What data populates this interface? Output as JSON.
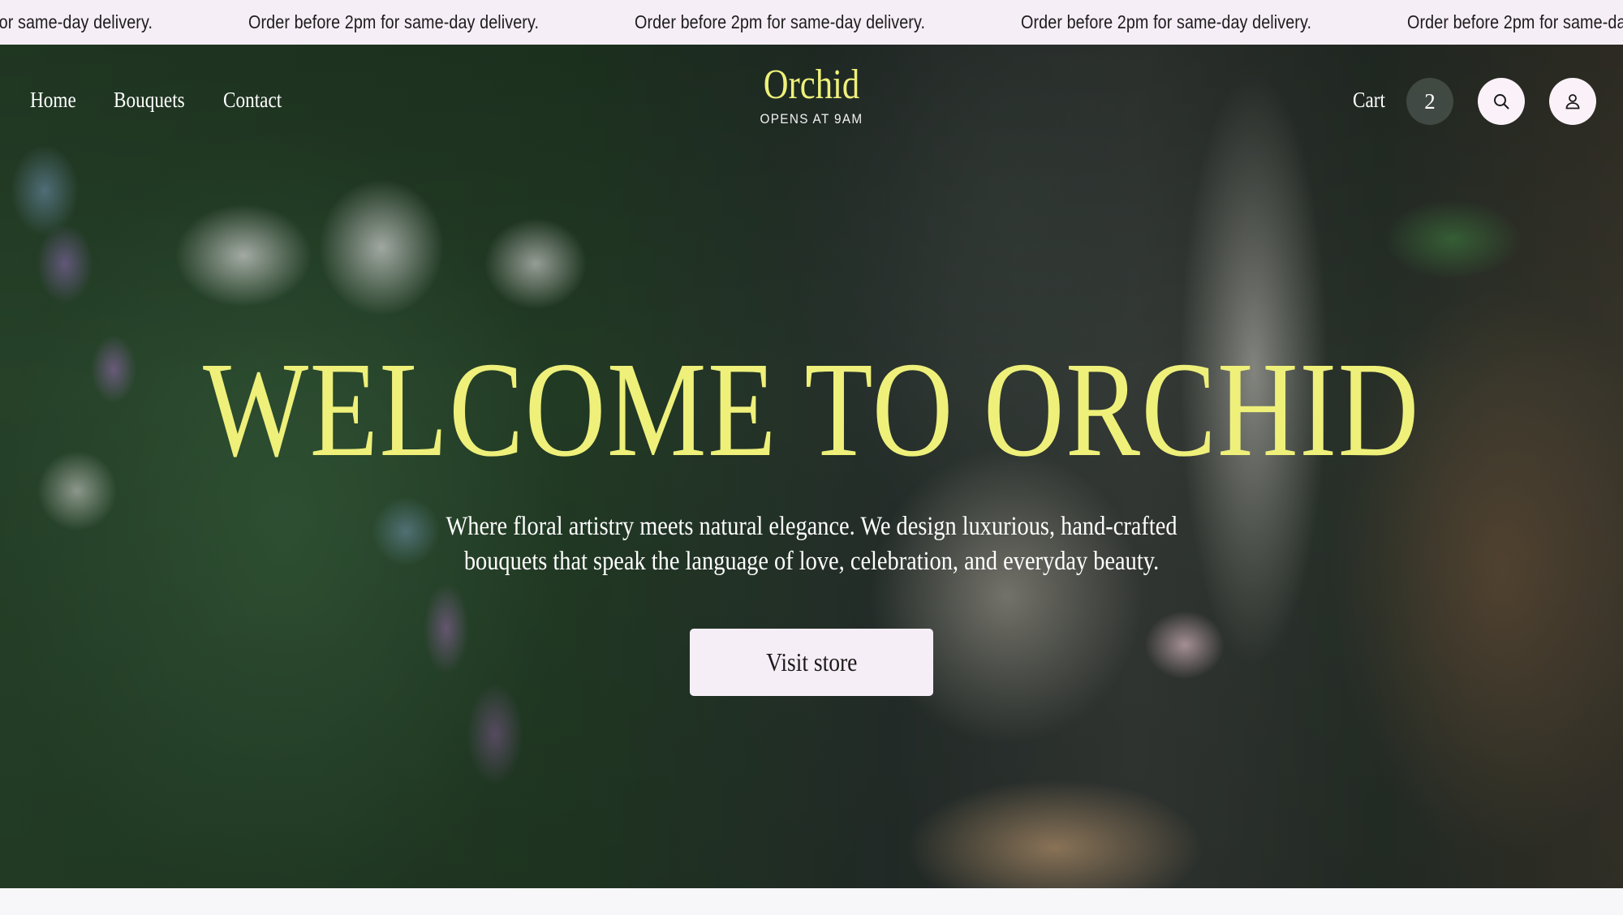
{
  "announcement": {
    "items": [
      "Order before 2pm for same-day delivery.",
      "Order before 2pm for same-day delivery.",
      "Order before 2pm for same-day delivery.",
      "Order before 2pm for same-day delivery.",
      "Order before 2pm for same-day delivery."
    ]
  },
  "nav": {
    "home": "Home",
    "bouquets": "Bouquets",
    "contact": "Contact"
  },
  "brand": {
    "title": "Orchid",
    "subtitle": "OPENS AT 9AM"
  },
  "actions": {
    "cart_label": "Cart",
    "cart_count": "2",
    "search_icon": "search-icon",
    "account_icon": "user-icon"
  },
  "hero": {
    "title": "WELCOME TO ORCHID",
    "description": "Where floral artistry meets natural elegance. We design luxurious, hand-crafted bouquets that speak the language of love, celebration, and everyday beauty.",
    "cta_label": "Visit store"
  },
  "colors": {
    "accent": "#eef07a",
    "announcement_bg": "#f6eef6",
    "button_bg": "#f6eef6"
  }
}
